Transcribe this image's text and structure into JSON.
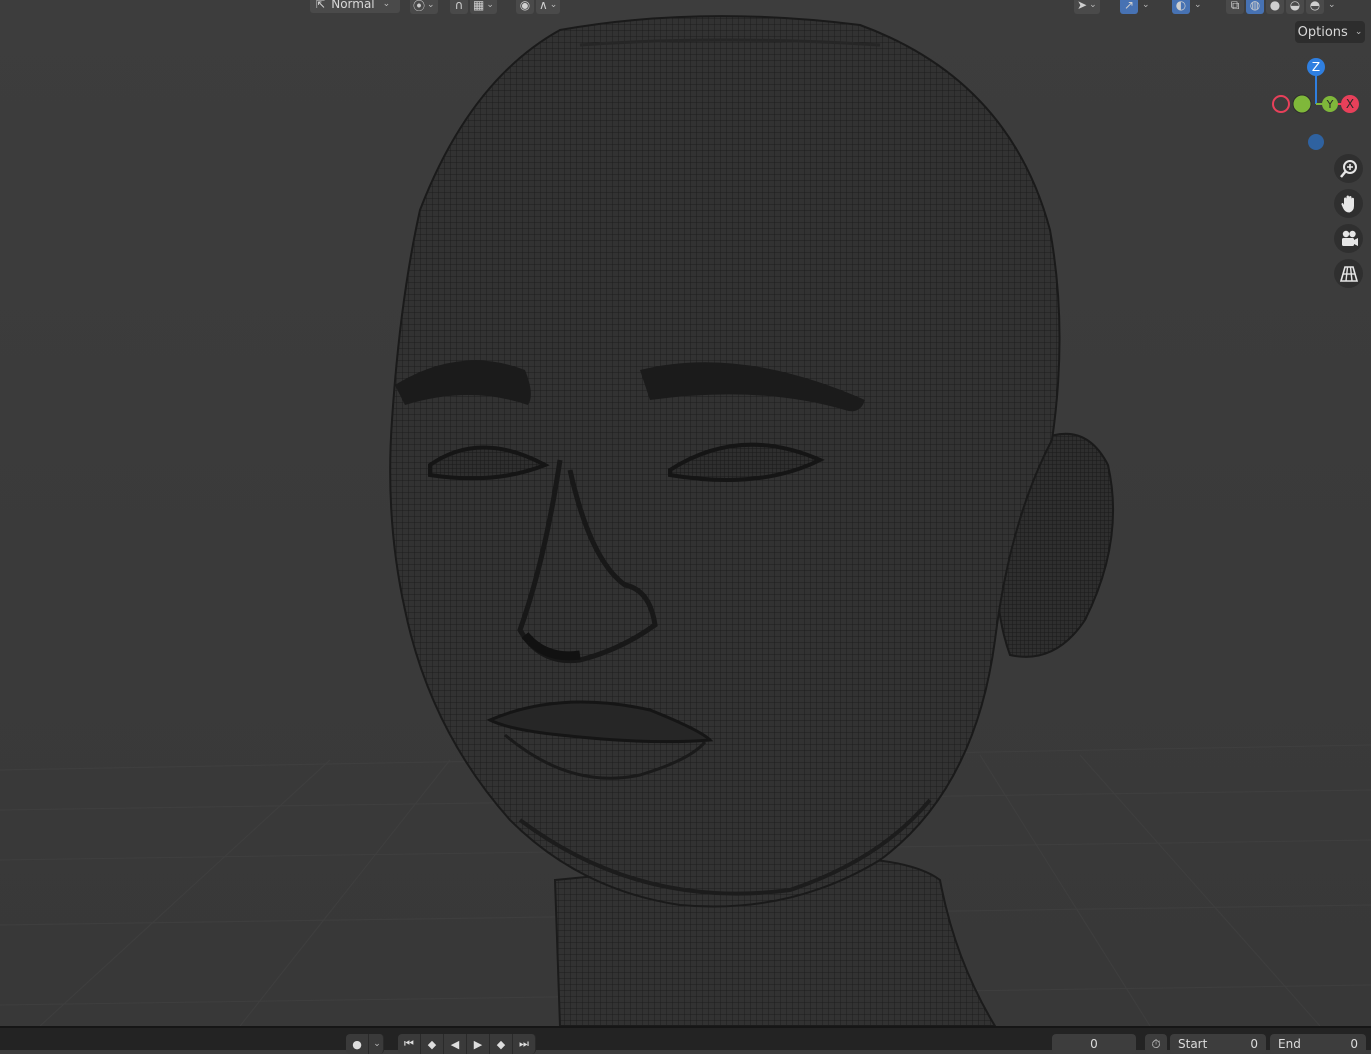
{
  "header": {
    "orientation_value": "Normal"
  },
  "viewport": {
    "options_label": "Options",
    "gizmo": {
      "z_label": "Z",
      "x_label": "X",
      "y_label": "Y"
    }
  },
  "timeline": {
    "current_frame": "0",
    "start_label": "Start",
    "start_value": "0",
    "end_label": "End",
    "end_value": "0"
  },
  "colors": {
    "axis_x": "#e8405a",
    "axis_y": "#7fb83a",
    "axis_z": "#2f7fe0",
    "accent": "#4772b3"
  }
}
